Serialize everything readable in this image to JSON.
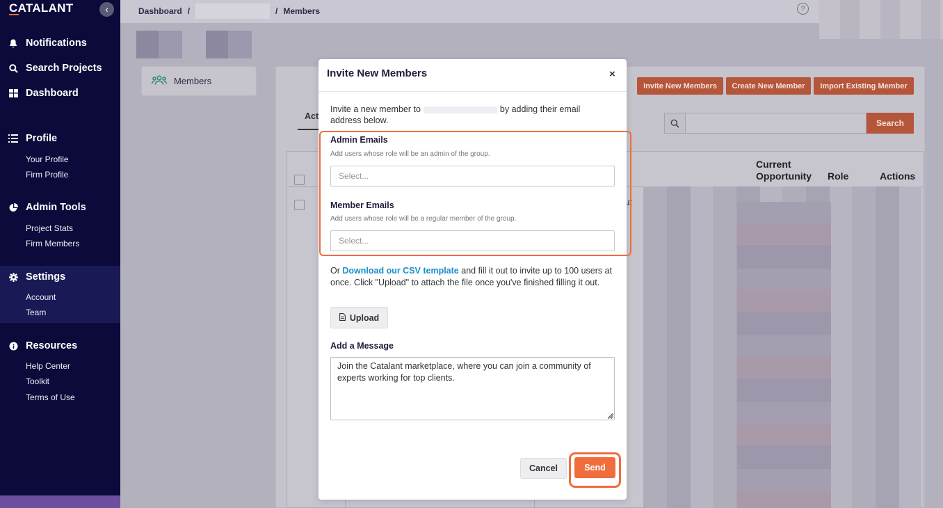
{
  "sidebar": {
    "logo": "CATALANT",
    "collapse_icon": "chevron-left-icon",
    "nav": [
      {
        "label": "Notifications",
        "icon": "bell-icon"
      },
      {
        "label": "Search Projects",
        "icon": "search-icon"
      },
      {
        "label": "Dashboard",
        "icon": "grid-icon"
      }
    ],
    "profile": {
      "label": "Profile",
      "icon": "list-icon",
      "items": [
        "Your Profile",
        "Firm Profile"
      ]
    },
    "admin_tools": {
      "label": "Admin Tools",
      "icon": "pie-chart-icon",
      "items": [
        "Project Stats",
        "Firm Members"
      ]
    },
    "settings": {
      "label": "Settings",
      "icon": "gear-icon",
      "items": [
        "Account",
        "Team"
      ]
    },
    "resources": {
      "label": "Resources",
      "icon": "info-icon",
      "items": [
        "Help Center",
        "Toolkit",
        "Terms of Use"
      ]
    }
  },
  "breadcrumb": {
    "root": "Dashboard",
    "sep1": "/",
    "sep2": "/",
    "current": "Members"
  },
  "help_icon": "?",
  "members_card": {
    "label": "Members",
    "icon": "users-icon"
  },
  "header_buttons": {
    "invite": "Invite New Members",
    "create": "Create New Member",
    "import": "Import Existing Member"
  },
  "tabs": {
    "active": "Act"
  },
  "search": {
    "button": "Search"
  },
  "table": {
    "headers": {
      "current_opportunity_1": "Current",
      "current_opportunity_2": "Opportunity",
      "role": "Role",
      "actions": "Actions"
    },
    "row_snippet": "olut"
  },
  "modal": {
    "title": "Invite New Members",
    "close": "×",
    "intro_before": "Invite a new member to",
    "intro_after": "by adding their email address below.",
    "admin_label": "Admin Emails",
    "admin_help": "Add users whose role will be an admin of the group.",
    "admin_placeholder": "Select...",
    "member_label": "Member Emails",
    "member_help": "Add users whose role will be a regular member of the group.",
    "member_placeholder": "Select...",
    "csv_prefix": "Or",
    "csv_link": "Download our CSV template",
    "csv_suffix": "and fill it out to invite up to 100 users at once. Click \"Upload\" to attach the file once you've finished filling it out.",
    "upload": "Upload",
    "message_label": "Add a Message",
    "message_value": "Join the Catalant marketplace, where you can join a community of experts working for top clients.",
    "cancel": "Cancel",
    "send": "Send"
  },
  "colors": {
    "accent": "#f06d3c",
    "sidebar": "#0b0a3b",
    "link": "#1a8fc9"
  }
}
